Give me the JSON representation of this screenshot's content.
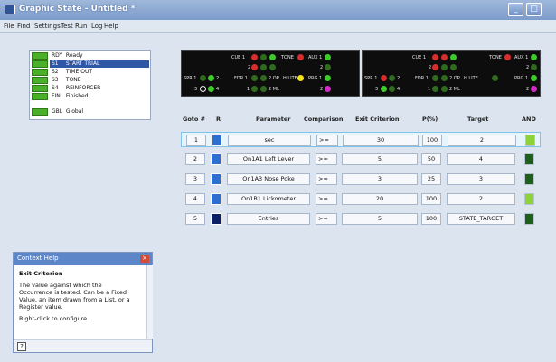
{
  "window": {
    "title": "Graphic State - Untitled *",
    "minimize_glyph": "_",
    "maximize_glyph": "□"
  },
  "menu": [
    "File",
    "Find",
    "Settings",
    "Test Run",
    "Log",
    "Help"
  ],
  "states": [
    {
      "code": "RDY",
      "name": "Ready",
      "selected": false
    },
    {
      "code": "S1",
      "name": "START TRIAL",
      "selected": true
    },
    {
      "code": "S2",
      "name": "TIME OUT",
      "selected": false
    },
    {
      "code": "S3",
      "name": "TONE",
      "selected": false
    },
    {
      "code": "S4",
      "name": "REINFORCER",
      "selected": false
    },
    {
      "code": "FIN",
      "name": "Finished",
      "selected": false
    },
    {
      "code": "GBL",
      "name": "Global",
      "selected": false
    }
  ],
  "panels": [
    {
      "labels": {
        "cue": "CUE 1",
        "tone": "TONE",
        "aux": "AUX 1",
        "aux2": "2",
        "cue2": "2",
        "prg": "PRG 1",
        "prg2": "2",
        "spr": "SPR 1",
        "spr2": "2",
        "spr3": "3",
        "spr4": "4",
        "fdr": "FDR 1",
        "fdr2": "2",
        "fdr_n": "1",
        "op": "2 OP",
        "hlite": "H LITE",
        "ml": "2 ML"
      }
    },
    {
      "labels": {
        "cue": "CUE 1",
        "tone": "TONE",
        "aux": "AUX 1",
        "aux2": "2",
        "cue2": "2",
        "prg": "PRG 1",
        "prg2": "2",
        "spr": "SPR 1",
        "spr2": "2",
        "spr3": "3",
        "spr4": "4",
        "fdr": "FDR 1",
        "fdr2": "2",
        "fdr_n": "1",
        "op": "2 OP",
        "hlite": "H LITE",
        "ml": "2 ML"
      }
    }
  ],
  "grid": {
    "headers": {
      "goto": "Goto #",
      "r": "R",
      "parameter": "Parameter",
      "comparison": "Comparison",
      "exit": "Exit Criterion",
      "p": "P(%)",
      "target": "Target",
      "and": "AND"
    },
    "rows": [
      {
        "goto": "1",
        "parameter": "sec",
        "comparison": ">=",
        "exit": "30",
        "p": "100",
        "target": "2"
      },
      {
        "goto": "2",
        "parameter": "On1A1 Left Lever",
        "comparison": ">=",
        "exit": "5",
        "p": "50",
        "target": "4"
      },
      {
        "goto": "3",
        "parameter": "On1A3 Nose Poke",
        "comparison": ">=",
        "exit": "3",
        "p": "25",
        "target": "3"
      },
      {
        "goto": "4",
        "parameter": "On1B1 Lickometer",
        "comparison": ">=",
        "exit": "20",
        "p": "100",
        "target": "2"
      },
      {
        "goto": "5",
        "parameter": "Entries",
        "comparison": ">=",
        "exit": "5",
        "p": "100",
        "target": "STATE_TARGET"
      }
    ]
  },
  "help": {
    "title": "Context Help",
    "close_glyph": "×",
    "heading": "Exit Criterion",
    "body": "The value against which the Occurrence is tested. Can be a Fixed Value, an item drawn from a List, or a Register value.",
    "hint": "Right-click to configure...",
    "help_glyph": "?"
  },
  "colors": {
    "accent": "#2f57a6",
    "state_on": "#4caf2a",
    "r_blue": "#2d6fd0",
    "r_navy": "#0b1f63",
    "and_lime": "#8ed23a",
    "and_dark": "#1e5f1a"
  }
}
